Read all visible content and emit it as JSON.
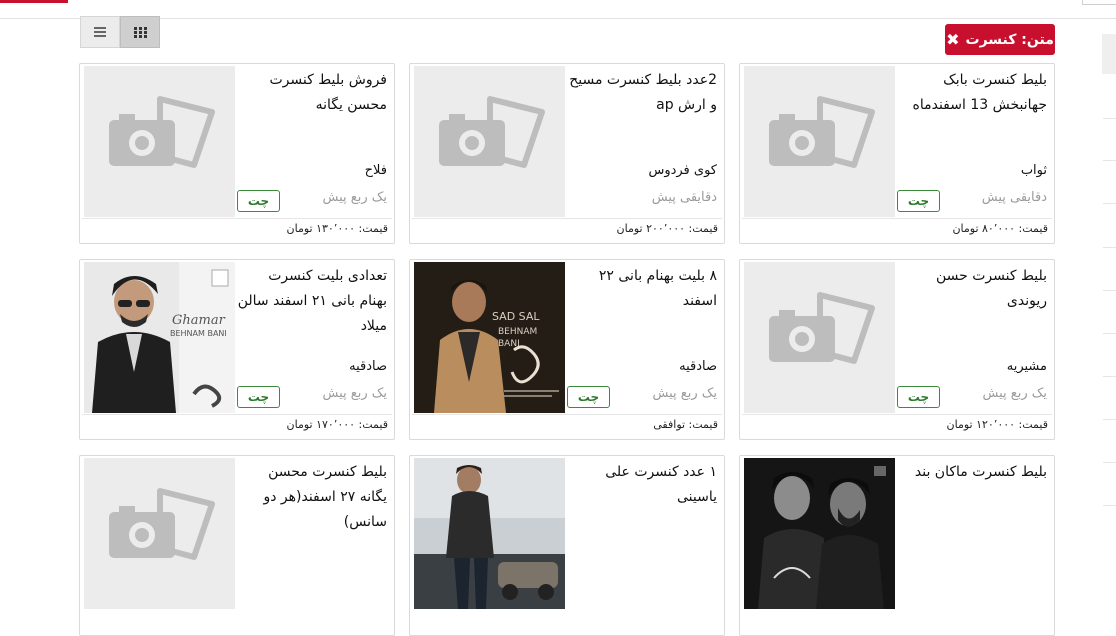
{
  "filter": {
    "label": "متن: کنسرت",
    "remove_glyph": "✖"
  },
  "view": {
    "grid_icon": "grid-icon",
    "list_icon": "list-icon",
    "active": "grid"
  },
  "colors": {
    "accent": "#c8102e",
    "chat_green": "#2b7a2b",
    "placeholder_bg": "#ececec"
  },
  "listings": [
    {
      "title": "بلیط کنسرت بابک جهانبخش 13 اسفندماه",
      "location": "ثواب",
      "time": "دقایقی پیش",
      "chat": "چت",
      "price": "قیمت: ۸۰٬۰۰۰ تومان",
      "image": "placeholder"
    },
    {
      "title": "2عدد بلیط کنسرت مسیح و ارش ap",
      "location": "کوی فردوس",
      "time": "دقایقی پیش",
      "chat": "چت",
      "price": "قیمت: ۲۰۰٬۰۰۰ تومان",
      "image": "placeholder"
    },
    {
      "title": "فروش بلیط کنسرت محسن یگانه",
      "location": "فلاح",
      "time": "یک ربع پیش",
      "chat": "چت",
      "price": "قیمت: ۱۳۰٬۰۰۰ تومان",
      "image": "placeholder"
    },
    {
      "title": "بلیط کنسرت حسن ریوندی",
      "location": "مشیریه",
      "time": "یک ربع پیش",
      "chat": "چت",
      "price": "قیمت: ۱۲۰٬۰۰۰ تومان",
      "image": "placeholder"
    },
    {
      "title": "۸ بلیت بهنام بانی ۲۲ اسفند",
      "location": "صادقیه",
      "time": "یک ربع پیش",
      "chat": "چت",
      "price": "قیمت: توافقی",
      "image": "photo",
      "photo_text": [
        "SAD SAL",
        "BEHNAM",
        "BANI"
      ]
    },
    {
      "title": "تعدادی بلیت کنسرت بهنام بانی ۲۱ اسفند سالن میلاد",
      "location": "صادقیه",
      "time": "یک ربع پیش",
      "chat": "چت",
      "price": "قیمت: ۱۷۰٬۰۰۰ تومان",
      "image": "photo",
      "photo_text": [
        "Ghamar",
        "BEHNAM BANI"
      ]
    },
    {
      "title": "بلیط کنسرت ماکان بند",
      "image": "photo"
    },
    {
      "title": "۱ عدد کنسرت علی یاسینی",
      "image": "photo"
    },
    {
      "title": "بلیط کنسرت محسن یگانه ۲۷ اسفند(هر دو سانس)",
      "image": "placeholder"
    }
  ]
}
